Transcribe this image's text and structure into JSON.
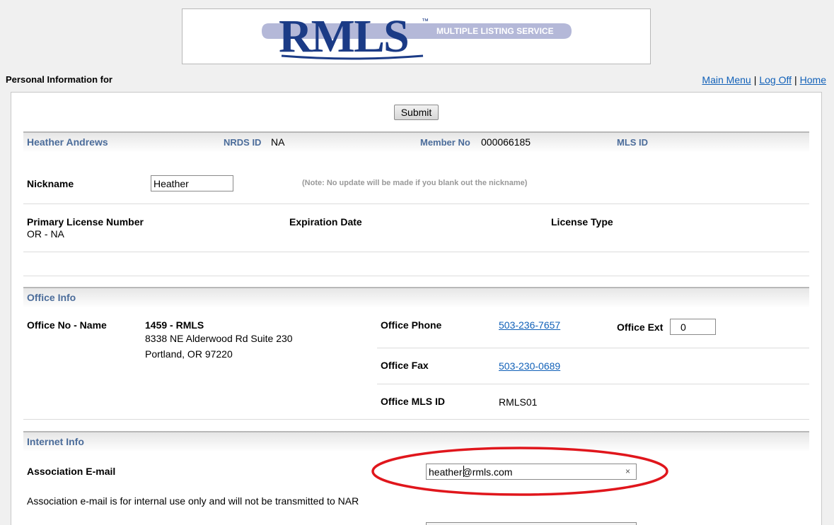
{
  "logo": {
    "brand": "RMLS",
    "tagline": "MULTIPLE LISTING SERVICE",
    "trademark": "™",
    "colors": {
      "navy": "#1b3b86",
      "band": "#b4b8d8",
      "tagline_text": "#ffffff"
    }
  },
  "header": {
    "heading": "Personal Information for",
    "links": [
      "Main Menu",
      "Log Off",
      "Home"
    ],
    "separator": "|"
  },
  "form": {
    "submit_label": "Submit"
  },
  "member": {
    "name": "Heather Andrews",
    "nrds_label": "NRDS ID",
    "nrds_value": "NA",
    "member_no_label": "Member No",
    "member_no_value": "000066185",
    "mls_id_label": "MLS ID",
    "mls_id_value": ""
  },
  "nickname": {
    "label": "Nickname",
    "value": "Heather",
    "note": "(Note: No update will be made if you blank out the nickname)"
  },
  "license": {
    "primary_label": "Primary License Number",
    "primary_value": "OR - NA",
    "expiration_label": "Expiration Date",
    "type_label": "License Type"
  },
  "office": {
    "section_title": "Office Info",
    "no_name_label": "Office No - Name",
    "no_name_value": "1459 - RMLS",
    "address_line1": "8338 NE Alderwood Rd Suite 230",
    "address_line2": "Portland, OR 97220",
    "phone_label": "Office Phone",
    "phone_value": "503-236-7657",
    "ext_label": "Office Ext",
    "ext_value": "0",
    "fax_label": "Office Fax",
    "fax_value": "503-230-0689",
    "mls_id_label": "Office MLS ID",
    "mls_id_value": "RMLS01"
  },
  "internet": {
    "section_title": "Internet Info",
    "email_label": "Association E-mail",
    "email_value": "heather@rmls.com",
    "email_note": "Association e-mail is for internal use only and will not be transmitted to NAR",
    "clear_glyph": "×"
  },
  "annotation": {
    "ellipse_color": "#e0161c"
  }
}
